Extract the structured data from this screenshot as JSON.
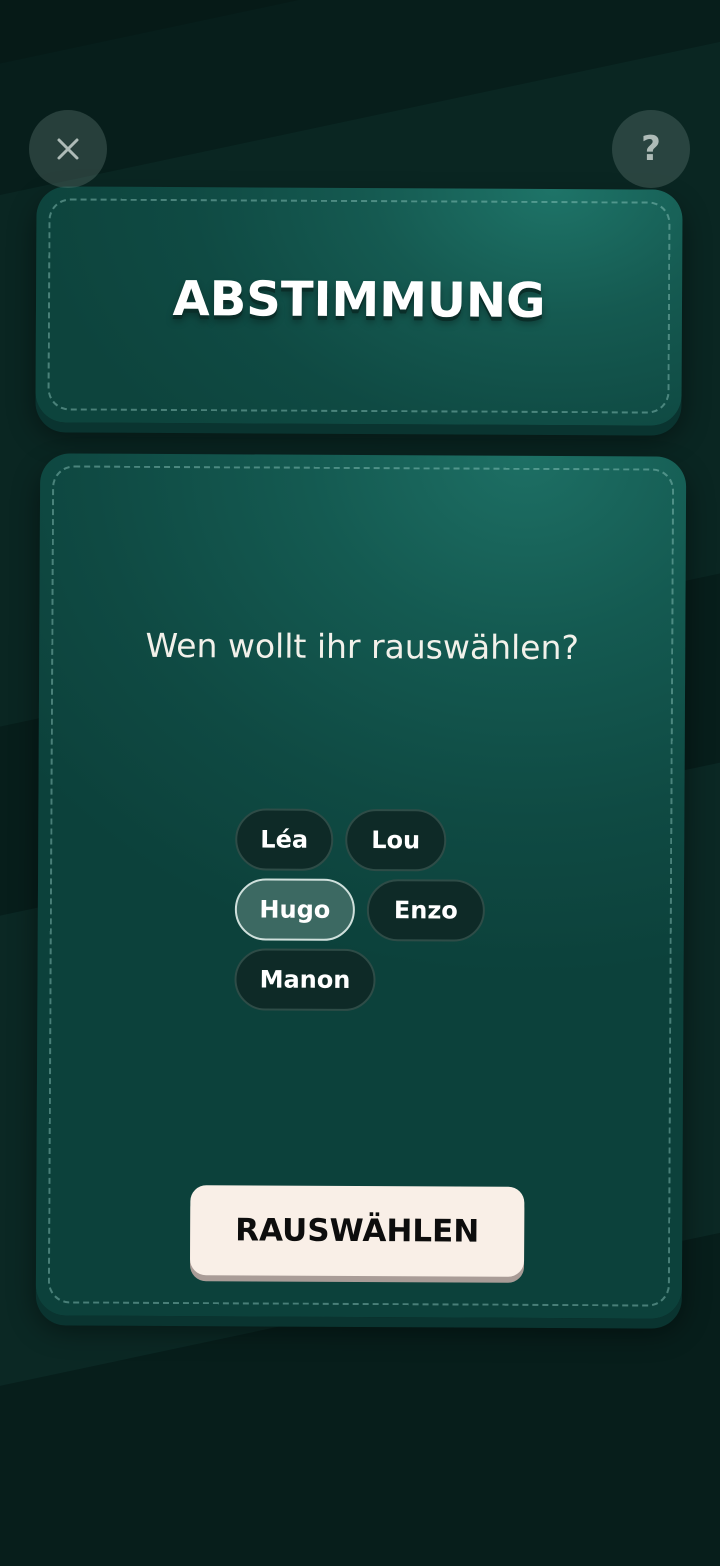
{
  "topbar": {
    "close_icon": "close-icon",
    "help_label": "?"
  },
  "header": {
    "title": "ABSTIMMUNG"
  },
  "vote": {
    "question": "Wen wollt ihr rauswählen?",
    "players": [
      {
        "name": "Léa",
        "selected": false
      },
      {
        "name": "Lou",
        "selected": false
      },
      {
        "name": "Hugo",
        "selected": true
      },
      {
        "name": "Enzo",
        "selected": false
      },
      {
        "name": "Manon",
        "selected": false
      }
    ],
    "submit_label": "RAUSWÄHLEN"
  },
  "colors": {
    "background": "#071e1b",
    "card": "#155a51",
    "chip": "#0e2a27",
    "chip_selected": "#3c6962",
    "button": "#f9efe7"
  }
}
